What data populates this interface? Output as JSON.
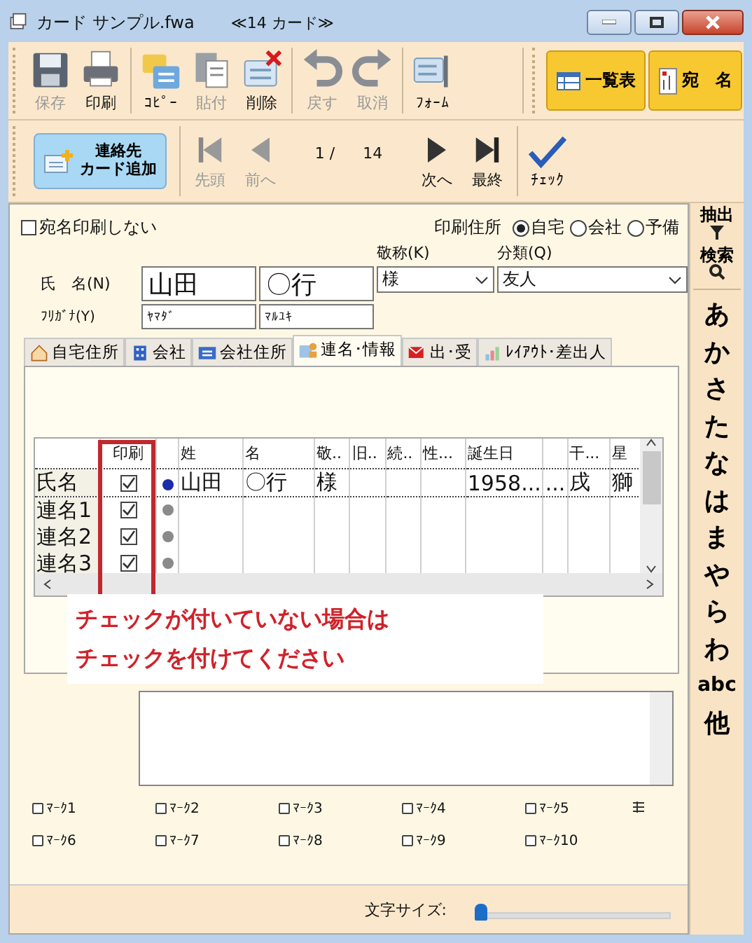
{
  "window": {
    "title": "カード サンプル.fwa",
    "subtitle": "≪14 カード≫"
  },
  "toolbar": [
    {
      "label": "保存",
      "disabled": true
    },
    {
      "label": "印刷",
      "disabled": false
    },
    {
      "label": "ｺﾋﾟｰ",
      "disabled": false
    },
    {
      "label": "貼付",
      "disabled": true
    },
    {
      "label": "削除",
      "disabled": false
    },
    {
      "label": "戻す",
      "disabled": true
    },
    {
      "label": "取消",
      "disabled": true
    },
    {
      "label": "ﾌｫｰﾑ",
      "disabled": false
    }
  ],
  "view_buttons": [
    "一覧表",
    "宛　名"
  ],
  "navbar": {
    "add_button": [
      "連絡先",
      "カード追加"
    ],
    "buttons": [
      {
        "label": "先頭",
        "disabled": true
      },
      {
        "label": "前へ",
        "disabled": true
      },
      {
        "label": "次へ",
        "disabled": false
      },
      {
        "label": "最終",
        "disabled": false
      }
    ],
    "position": "1 /",
    "total": "14",
    "check": "ﾁｪｯｸ"
  },
  "index": {
    "extract": "抽出",
    "search": "検索",
    "letters": [
      "あ",
      "か",
      "さ",
      "た",
      "な",
      "は",
      "ま",
      "や",
      "ら",
      "わ",
      "abc",
      "他"
    ]
  },
  "form": {
    "no_print": {
      "label": "宛名印刷しない",
      "checked": false
    },
    "print_address": {
      "label": "印刷住所",
      "options": [
        {
          "label": "自宅",
          "selected": true
        },
        {
          "label": "会社",
          "selected": false
        },
        {
          "label": "予備",
          "selected": false
        }
      ]
    },
    "name_label": "氏　名(N)",
    "family": "山田",
    "given": "〇行",
    "kana_label": "ﾌﾘｶﾞﾅ(Y)",
    "family_kana": "ﾔﾏﾀﾞ",
    "given_kana": "ﾏﾙﾕｷ",
    "honorific_label": "敬称(K)",
    "honorific": "様",
    "category_label": "分類(Q)",
    "category": "友人"
  },
  "tabs": [
    {
      "label": "自宅住所",
      "selected": false
    },
    {
      "label": "会社",
      "selected": false
    },
    {
      "label": "会社住所",
      "selected": false
    },
    {
      "label": "連名･情報",
      "selected": true
    },
    {
      "label": "出･受",
      "selected": false
    },
    {
      "label": "ﾚｲｱｳﾄ･差出人",
      "selected": false
    }
  ],
  "grid": {
    "print_column": "印刷",
    "columns": [
      "姓",
      "名",
      "敬..",
      "旧..",
      "続..",
      "性...",
      "誕生日",
      null,
      "干...",
      "星"
    ],
    "rows": [
      {
        "label": "氏名",
        "checked": true,
        "color": "#1a2aa8",
        "cells": [
          "山田",
          "〇行",
          "様",
          null,
          null,
          null,
          "1958...",
          "...",
          "戌",
          "獅"
        ]
      },
      {
        "label": "連名1",
        "checked": true,
        "color": "#8a8a8a"
      },
      {
        "label": "連名2",
        "checked": true,
        "color": "#8a8a8a"
      },
      {
        "label": "連名3",
        "checked": true,
        "color": "#8a8a8a"
      }
    ]
  },
  "callout": [
    "チェックが付いていない場合は",
    "チェックを付けてください"
  ],
  "marks": [
    {
      "label": "ﾏｰｸ1",
      "checked": false
    },
    {
      "label": "ﾏｰｸ2",
      "checked": false
    },
    {
      "label": "ﾏｰｸ3",
      "checked": false
    },
    {
      "label": "ﾏｰｸ4",
      "checked": false
    },
    {
      "label": "ﾏｰｸ5",
      "checked": false
    },
    {
      "label": "ﾏｰｸ6",
      "checked": false
    },
    {
      "label": "ﾏｰｸ7",
      "checked": false
    },
    {
      "label": "ﾏｰｸ8",
      "checked": false
    },
    {
      "label": "ﾏｰｸ9",
      "checked": false
    },
    {
      "label": "ﾏｰｸ10",
      "checked": false
    }
  ],
  "font_size": {
    "label": "文字サイズ:",
    "level": 0
  }
}
